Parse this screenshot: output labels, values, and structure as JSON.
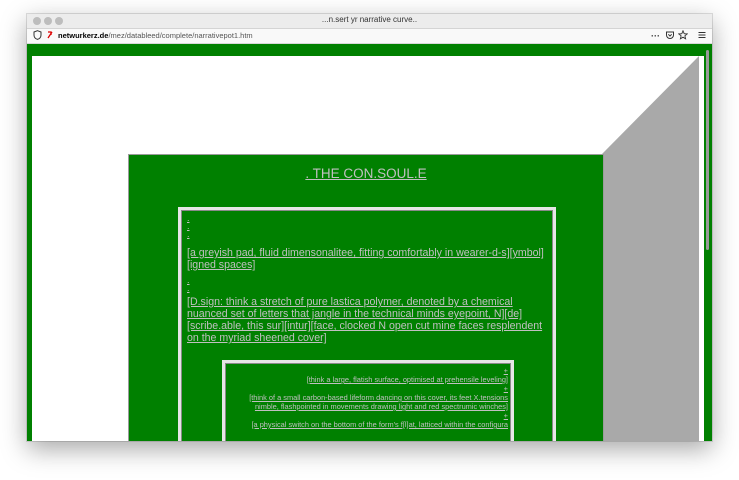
{
  "browser": {
    "title": "...n.sert yr narrative curve..",
    "url_domain": "netwurkerz.de",
    "url_path": "/mez/datableed/complete/narrativepot1.htm"
  },
  "page": {
    "heading": ". THE CON.SOUL.E",
    "dots_top": [
      ".",
      ".",
      "."
    ],
    "para1": "[a greyish pad, fluid dimensonalitee, fitting comfortably in wearer-d-s][ymbol][igned spaces]",
    "dots_mid": [
      ".",
      "."
    ],
    "para2": "[D.sign: think a stretch of pure lastica polymer, denoted by a chemical nuanced set of letters that jangle in the technical minds eyepoint, N][de][scribe.able, this sur][intur][face, clocked N open cut mine faces resplendent on the myriad sheened cover]",
    "inner": {
      "plus1": "+",
      "line1": "[think a large, flatish surface, optimised at prehensile leveling]",
      "plus2": "+",
      "line2": "[think of a small carbon-based lifeform dancing on this cover, its feet X.tensions nimble, flashpointed in movements drawing light and red spectrumic winches]",
      "plus3": "+",
      "line3": "[a physical switch on the bottom of the form's f[l]at, latticed within the configura"
    }
  },
  "colors": {
    "page_green": "#008000",
    "link_gray": "#c0c0c0",
    "bevel_gray": "#a9a9a9"
  },
  "icons": [
    "shield-icon",
    "tracking-icon",
    "more-icon",
    "pocket-icon",
    "bookmark-star-icon",
    "menu-icon"
  ]
}
